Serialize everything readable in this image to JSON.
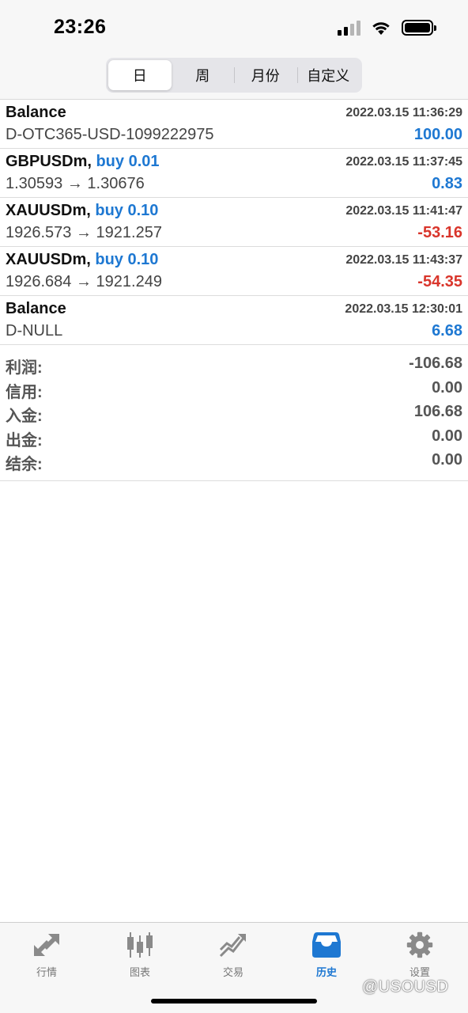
{
  "status_bar": {
    "time": "23:26"
  },
  "period_tabs": [
    {
      "label": "日",
      "active": true
    },
    {
      "label": "周",
      "active": false
    },
    {
      "label": "月份",
      "active": false
    },
    {
      "label": "自定义",
      "active": false
    }
  ],
  "deals": [
    {
      "symbol": "Balance",
      "trade": "",
      "time": "2022.03.15 11:36:29",
      "detail": "D-OTC365-USD-1099222975",
      "amount": "100.00",
      "sign": "pos"
    },
    {
      "symbol": "GBPUSDm,",
      "trade": "buy 0.01",
      "time": "2022.03.15 11:37:45",
      "detail": "1.30593 → 1.30676",
      "amount": "0.83",
      "sign": "pos"
    },
    {
      "symbol": "XAUUSDm,",
      "trade": "buy 0.10",
      "time": "2022.03.15 11:41:47",
      "detail": "1926.573 → 1921.257",
      "amount": "-53.16",
      "sign": "neg"
    },
    {
      "symbol": "XAUUSDm,",
      "trade": "buy 0.10",
      "time": "2022.03.15 11:43:37",
      "detail": "1926.684 → 1921.249",
      "amount": "-54.35",
      "sign": "neg"
    },
    {
      "symbol": "Balance",
      "trade": "",
      "time": "2022.03.15 12:30:01",
      "detail": "D-NULL",
      "amount": "6.68",
      "sign": "pos"
    }
  ],
  "summary": [
    {
      "label": "利润:",
      "value": "-106.68"
    },
    {
      "label": "信用:",
      "value": "0.00"
    },
    {
      "label": "入金:",
      "value": "106.68"
    },
    {
      "label": "出金:",
      "value": "0.00"
    },
    {
      "label": "结余:",
      "value": "0.00"
    }
  ],
  "tab_bar": [
    {
      "label": "行情",
      "icon": "quotes-arrows-icon",
      "active": false
    },
    {
      "label": "图表",
      "icon": "candlestick-chart-icon",
      "active": false
    },
    {
      "label": "交易",
      "icon": "trade-trend-icon",
      "active": false
    },
    {
      "label": "历史",
      "icon": "history-inbox-icon",
      "active": true
    },
    {
      "label": "设置",
      "icon": "gear-icon",
      "active": false
    }
  ],
  "watermark": "@USOUSD",
  "colors": {
    "accent": "#1e78d2",
    "negative": "#d9352b",
    "text_gray": "#444444"
  }
}
